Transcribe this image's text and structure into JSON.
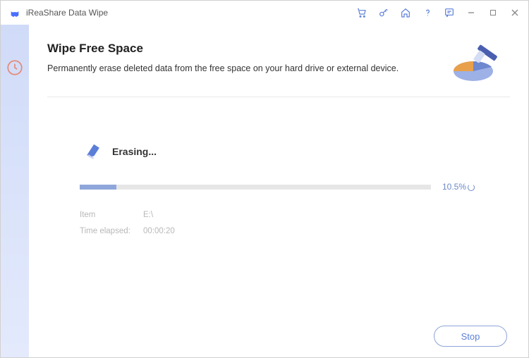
{
  "title": "iReaShare Data Wipe",
  "page": {
    "title": "Wipe Free Space",
    "description": "Permanently erase deleted data from the free space on your hard drive or external device."
  },
  "progress": {
    "status_label": "Erasing...",
    "percent_display": "10.5%",
    "percent_value": 10.5,
    "item_label": "Item",
    "item_value": "E:\\",
    "time_label": "Time elapsed:",
    "time_value": "00:00:20"
  },
  "footer": {
    "stop_label": "Stop"
  }
}
